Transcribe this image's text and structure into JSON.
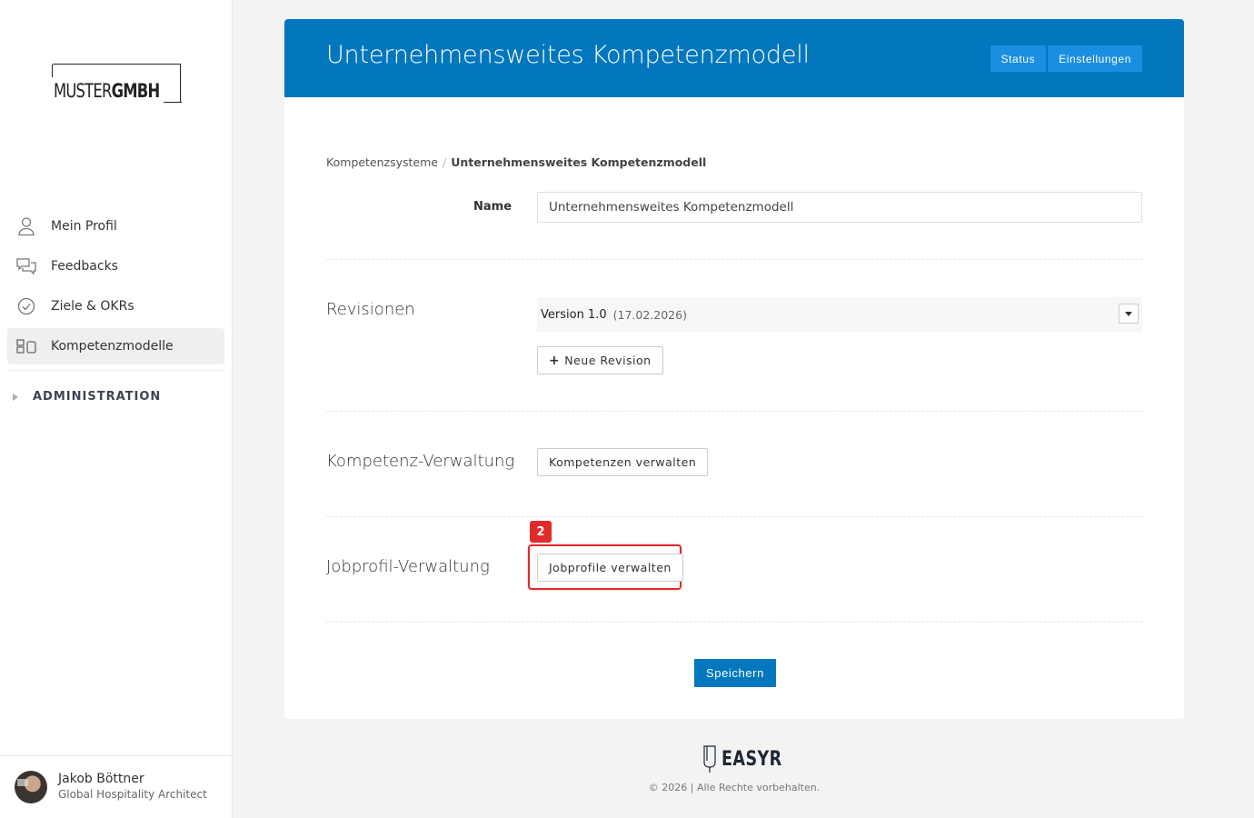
{
  "sidebar": {
    "logo": {
      "light": "MUSTER",
      "bold": "GMBH"
    },
    "items": [
      {
        "label": "Mein Profil",
        "icon": "user-icon"
      },
      {
        "label": "Feedbacks",
        "icon": "chat-bubbles-icon"
      },
      {
        "label": "Ziele & OKRs",
        "icon": "check-circle-icon"
      },
      {
        "label": "Kompetenzmodelle",
        "icon": "competency-model-icon",
        "active": true
      }
    ],
    "admin_label": "ADMINISTRATION",
    "user": {
      "name": "Jakob Böttner",
      "role": "Global Hospitality Architect"
    }
  },
  "header": {
    "title": "Unternehmensweites Kompetenzmodell",
    "status_label": "Status",
    "settings_label": "Einstellungen",
    "color": "#0277bd"
  },
  "breadcrumb": {
    "parent": "Kompetenzsysteme",
    "separator": "/",
    "current": "Unternehmensweites Kompetenzmodell"
  },
  "form": {
    "name_label": "Name",
    "name_value": "Unternehmensweites Kompetenzmodell",
    "revisions": {
      "label": "Revisionen",
      "selected_version": "Version 1.0",
      "selected_date": "(17.02.2026)",
      "new_revision_label": "Neue Revision"
    },
    "competency": {
      "label": "Kompetenz-Verwaltung",
      "button_label": "Kompetenzen verwalten"
    },
    "jobprofile": {
      "label": "Jobprofil-Verwaltung",
      "button_label": "Jobprofile verwalten",
      "annotation_number": "2",
      "annotation_color": "#e12a2a"
    },
    "save_label": "Speichern"
  },
  "footer": {
    "brand": "EASYR",
    "copyright": "© 2026 | Alle Rechte vorbehalten."
  }
}
